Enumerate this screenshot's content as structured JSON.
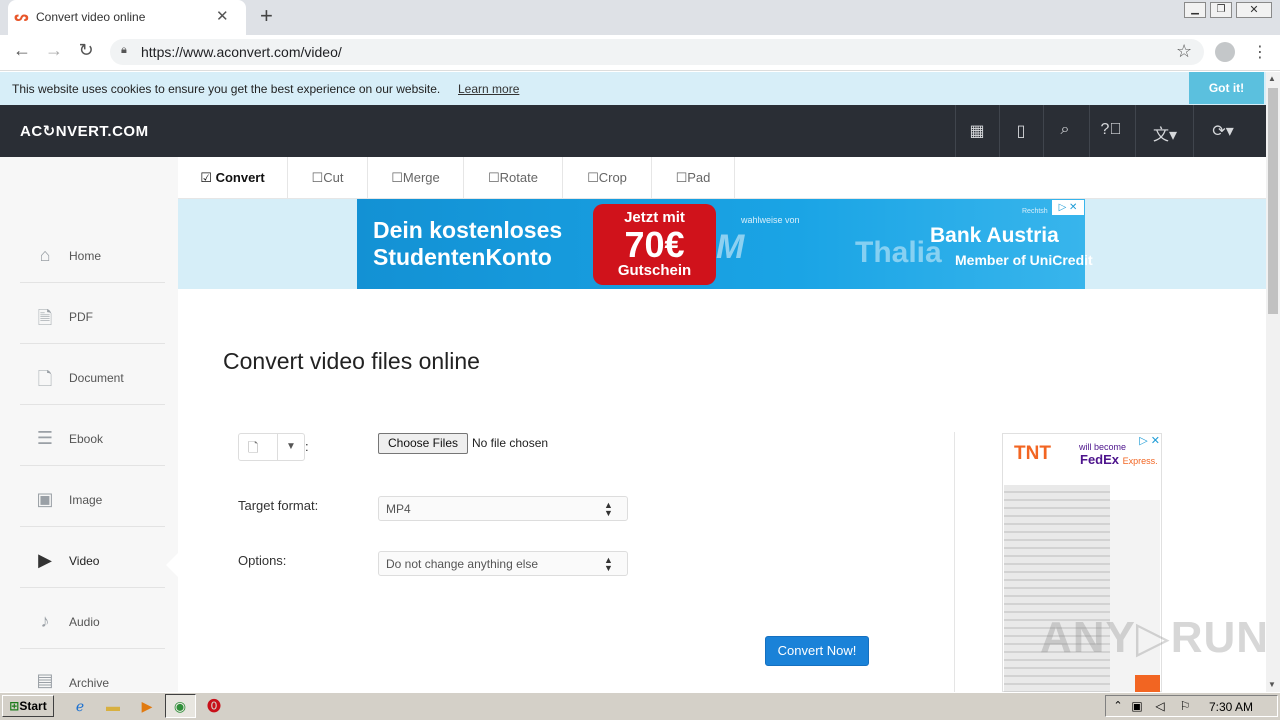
{
  "browser": {
    "tab_title": "Convert video online",
    "url": "https://www.aconvert.com/video/",
    "new_tab_glyph": "+",
    "close_glyph": "✕"
  },
  "cookie_bar": {
    "text": "This website uses cookies to ensure you get the best experience on our website.",
    "link": "Learn more",
    "button": "Got it!"
  },
  "site": {
    "logo": "AC↻NVERT.COM"
  },
  "sidebar": {
    "items": [
      {
        "label": "Home",
        "icon": "home-icon"
      },
      {
        "label": "PDF",
        "icon": "pdf-icon"
      },
      {
        "label": "Document",
        "icon": "document-icon"
      },
      {
        "label": "Ebook",
        "icon": "ebook-icon"
      },
      {
        "label": "Image",
        "icon": "image-icon"
      },
      {
        "label": "Video",
        "icon": "video-icon"
      },
      {
        "label": "Audio",
        "icon": "audio-icon"
      },
      {
        "label": "Archive",
        "icon": "archive-icon"
      }
    ],
    "active": "Video"
  },
  "operation_tabs": [
    {
      "label": "Convert",
      "checked": true
    },
    {
      "label": "Cut",
      "checked": false
    },
    {
      "label": "Merge",
      "checked": false
    },
    {
      "label": "Rotate",
      "checked": false
    },
    {
      "label": "Crop",
      "checked": false
    },
    {
      "label": "Pad",
      "checked": false
    }
  ],
  "ad_banner": {
    "headline_line1": "Dein kostenloses",
    "headline_line2": "StudentenKonto",
    "badge_line1": "Jetzt mit",
    "badge_line2": "70€",
    "badge_line3": "Gutschein",
    "small_text": "wahlweise von",
    "bank": "Bank Austria",
    "member": "Member of UniCredit",
    "thalia": "Thalia",
    "rechts": "Rechtsh"
  },
  "main": {
    "title": "Convert video files online",
    "file_colon": ":",
    "choose_files": "Choose Files",
    "no_file": "No file chosen",
    "target_format_label": "Target format:",
    "target_format_value": "MP4",
    "options_label": "Options:",
    "options_value": "Do not change anything else",
    "convert_button": "Convert Now!"
  },
  "side_ad": {
    "brand1": "TNT",
    "will_become": "will become",
    "brand2": "FedEx",
    "brand2_suffix": "Express."
  },
  "watermark": "ANY▷RUN",
  "taskbar": {
    "start": "Start",
    "clock": "7:30 AM"
  },
  "colors": {
    "header_bg": "#2a2e35",
    "cookie_bg": "#d7eef8",
    "accent_button": "#1a82d8",
    "cookie_button": "#5bc0de"
  }
}
